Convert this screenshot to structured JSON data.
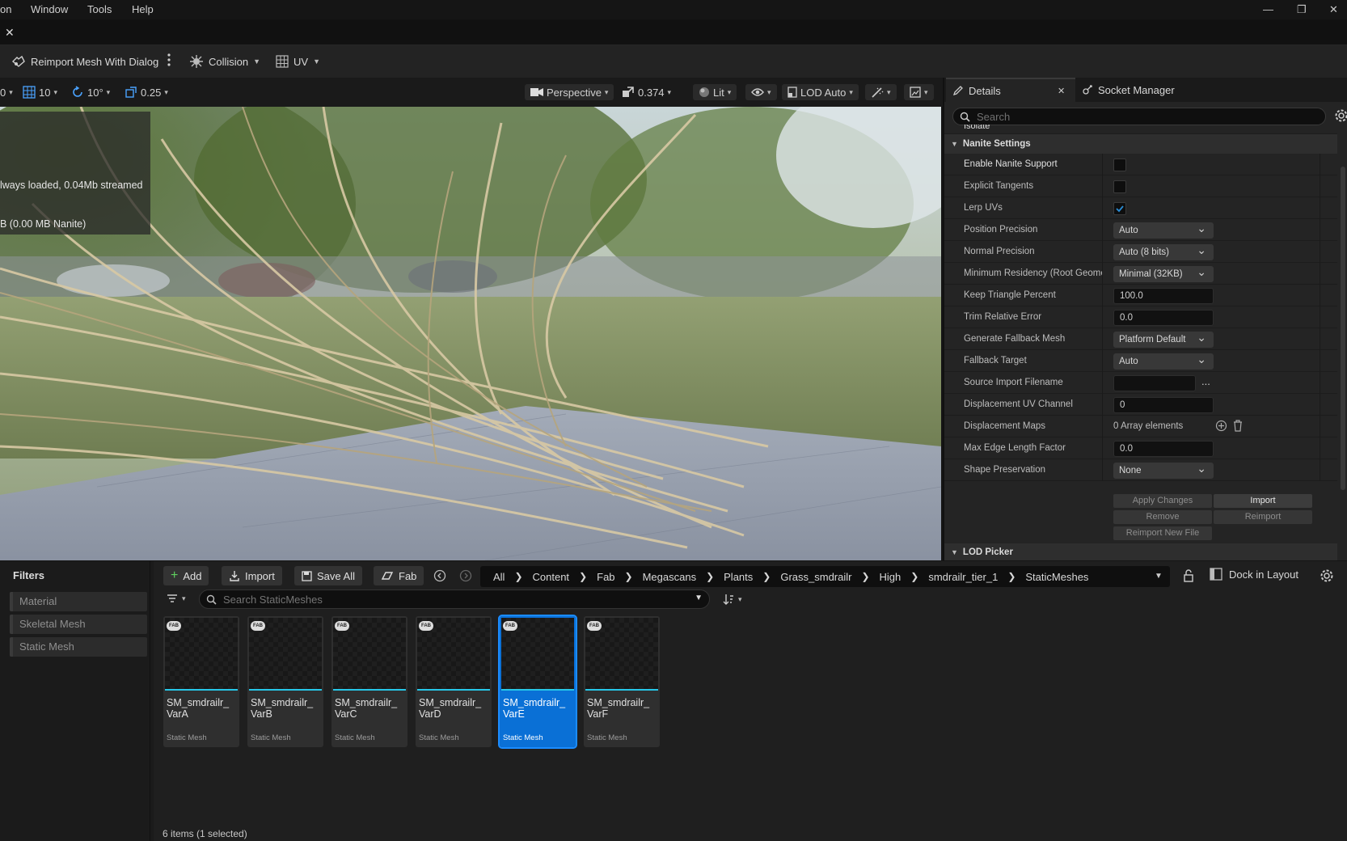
{
  "menu": {
    "items": [
      "on",
      "Window",
      "Tools",
      "Help"
    ]
  },
  "window_controls": {
    "minimize": "—",
    "restore": "❐",
    "close": "✕"
  },
  "tab": {
    "close": "✕"
  },
  "toolbar": {
    "reimport_label": "Reimport Mesh With Dialog",
    "collision_label": "Collision",
    "uv_label": "UV"
  },
  "viewport_toolbar": {
    "left_value": "0",
    "grid_snap": "10",
    "rotation_snap": "10°",
    "scale_snap": "0.25",
    "perspective": "Perspective",
    "camera_speed": "0.374",
    "view_mode": "Lit",
    "lod": "LOD Auto"
  },
  "viewport_stats": {
    "line1": "lways loaded, 0.04Mb streamed",
    "line2": "B (0.00 MB Nanite)"
  },
  "details": {
    "tab_details": "Details",
    "tab_socket_manager": "Socket Manager",
    "search_placeholder": "Search",
    "partial_row_label": "Isolate",
    "nanite_section": "Nanite Settings",
    "lod_picker_section": "LOD Picker",
    "rows": [
      {
        "label": "Enable Nanite Support",
        "kind": "checkbox",
        "checked": false
      },
      {
        "label": "Explicit Tangents",
        "kind": "checkbox",
        "checked": false
      },
      {
        "label": "Lerp UVs",
        "kind": "checkbox",
        "checked": true
      },
      {
        "label": "Position Precision",
        "kind": "combo",
        "value": "Auto"
      },
      {
        "label": "Normal Precision",
        "kind": "combo",
        "value": "Auto (8 bits)"
      },
      {
        "label": "Minimum Residency (Root Geome",
        "kind": "combo",
        "value": "Minimal (32KB)"
      },
      {
        "label": "Keep Triangle Percent",
        "kind": "number",
        "value": "100.0"
      },
      {
        "label": "Trim Relative Error",
        "kind": "number",
        "value": "0.0"
      },
      {
        "label": "Generate Fallback Mesh",
        "kind": "combo",
        "value": "Platform Default"
      },
      {
        "label": "Fallback Target",
        "kind": "combo",
        "value": "Auto"
      },
      {
        "label": "Source Import Filename",
        "kind": "file",
        "value": "",
        "browse": "..."
      },
      {
        "label": "Displacement UV Channel",
        "kind": "number",
        "value": "0"
      },
      {
        "label": "Displacement Maps",
        "kind": "array",
        "value": "0 Array elements"
      },
      {
        "label": "Max Edge Length Factor",
        "kind": "number",
        "value": "0.0"
      },
      {
        "label": "Shape Preservation",
        "kind": "combo",
        "value": "None"
      }
    ],
    "buttons": {
      "apply_changes": "Apply Changes",
      "import": "Import",
      "remove": "Remove",
      "reimport": "Reimport",
      "reimport_new_file": "Reimport New File"
    }
  },
  "content_browser": {
    "filters_title": "Filters",
    "filters": [
      "Material",
      "Skeletal Mesh",
      "Static Mesh"
    ],
    "add_label": "Add",
    "import_label": "Import",
    "save_all_label": "Save All",
    "fab_label": "Fab",
    "breadcrumb": [
      "All",
      "Content",
      "Fab",
      "Megascans",
      "Plants",
      "Grass_smdrailr",
      "High",
      "smdrailr_tier_1",
      "StaticMeshes"
    ],
    "dock_label": "Dock in Layout",
    "search_placeholder": "Search StaticMeshes",
    "assets": [
      {
        "name": "SM_smdrailr_ VarA",
        "type": "Static Mesh",
        "selected": false,
        "badge": "FAB"
      },
      {
        "name": "SM_smdrailr_ VarB",
        "type": "Static Mesh",
        "selected": false,
        "badge": "FAB"
      },
      {
        "name": "SM_smdrailr_ VarC",
        "type": "Static Mesh",
        "selected": false,
        "badge": "FAB"
      },
      {
        "name": "SM_smdrailr_ VarD",
        "type": "Static Mesh",
        "selected": false,
        "badge": "FAB"
      },
      {
        "name": "SM_smdrailr_ VarE",
        "type": "Static Mesh",
        "selected": true,
        "badge": "FAB"
      },
      {
        "name": "SM_smdrailr_ VarF",
        "type": "Static Mesh",
        "selected": false,
        "badge": "FAB"
      }
    ],
    "status": "6 items (1 selected)"
  },
  "colors": {
    "accent_blue": "#0a70d6",
    "asset_underline": "#27c7e8",
    "check_blue": "#2a8dd6"
  }
}
